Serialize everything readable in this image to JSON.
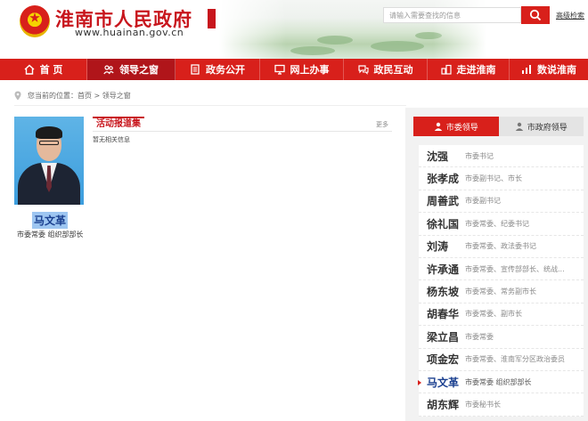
{
  "header": {
    "site_title": "淮南市人民政府",
    "site_url": "www.huainan.gov.cn",
    "search_placeholder": "请输入需要查找的信息",
    "advanced_search": "高级检索"
  },
  "nav": {
    "items": [
      {
        "label": "首 页",
        "icon": "home-icon"
      },
      {
        "label": "领导之窗",
        "icon": "leaders-icon",
        "active": true
      },
      {
        "label": "政务公开",
        "icon": "document-icon"
      },
      {
        "label": "网上办事",
        "icon": "monitor-icon"
      },
      {
        "label": "政民互动",
        "icon": "interaction-icon"
      },
      {
        "label": "走进淮南",
        "icon": "city-icon"
      },
      {
        "label": "数说淮南",
        "icon": "chart-icon"
      }
    ]
  },
  "breadcrumb": {
    "text": "您当前的位置：首页 > 领导之窗"
  },
  "profile": {
    "name": "马文革",
    "title": "市委常委 组织部部长"
  },
  "activity": {
    "tab_label": "活动报道集",
    "more": "更多",
    "empty": "暂无相关信息"
  },
  "panel": {
    "tabs": [
      {
        "label": "市委领导",
        "active": true
      },
      {
        "label": "市政府领导",
        "active": false
      }
    ],
    "leaders": [
      {
        "name": "沈强",
        "position": "市委书记"
      },
      {
        "name": "张孝成",
        "position": "市委副书记、市长"
      },
      {
        "name": "周善武",
        "position": "市委副书记"
      },
      {
        "name": "徐礼国",
        "position": "市委常委、纪委书记"
      },
      {
        "name": "刘涛",
        "position": "市委常委、政法委书记"
      },
      {
        "name": "许承通",
        "position": "市委常委、宣传部部长、统战..."
      },
      {
        "name": "杨东坡",
        "position": "市委常委、常务副市长"
      },
      {
        "name": "胡春华",
        "position": "市委常委、副市长"
      },
      {
        "name": "梁立昌",
        "position": "市委常委"
      },
      {
        "name": "项金宏",
        "position": "市委常委、淮南军分区政治委员"
      },
      {
        "name": "马文革",
        "position": "市委常委 组织部部长",
        "current": true
      },
      {
        "name": "胡东辉",
        "position": "市委秘书长"
      }
    ]
  },
  "colors": {
    "brand_red": "#d8201b",
    "active_nav": "#b0151a",
    "name_highlight": "#9ec6f1"
  }
}
